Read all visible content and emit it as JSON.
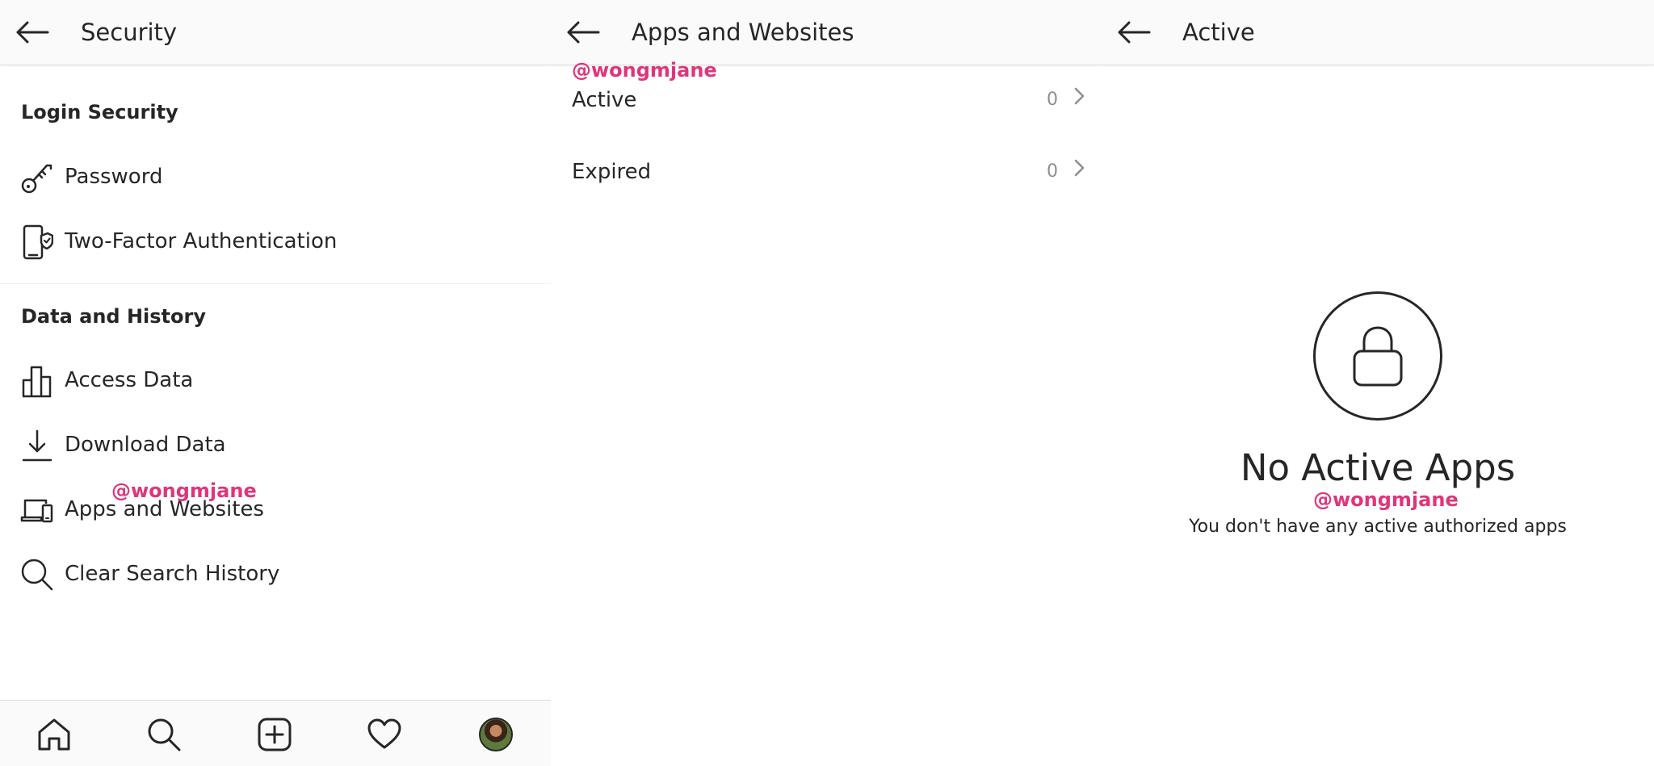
{
  "panels": {
    "security": {
      "title": "Security",
      "login_section": {
        "title": "Login Security",
        "items": [
          {
            "label": "Password",
            "icon": "key-icon"
          },
          {
            "label": "Two-Factor Authentication",
            "icon": "phone-shield-icon"
          }
        ]
      },
      "data_section": {
        "title": "Data and History",
        "items": [
          {
            "label": "Access Data",
            "icon": "bar-chart-icon"
          },
          {
            "label": "Download Data",
            "icon": "download-icon"
          },
          {
            "label": "Apps and Websites",
            "icon": "devices-icon"
          },
          {
            "label": "Clear Search History",
            "icon": "search-icon"
          }
        ]
      },
      "watermark": "@wongmjane",
      "tabbar": [
        {
          "name": "home",
          "icon": "home-icon"
        },
        {
          "name": "search",
          "icon": "search-icon"
        },
        {
          "name": "new-post",
          "icon": "plus-square-icon"
        },
        {
          "name": "activity",
          "icon": "heart-icon"
        },
        {
          "name": "profile",
          "icon": "avatar"
        }
      ]
    },
    "apps": {
      "title": "Apps and Websites",
      "watermark": "@wongmjane",
      "rows": [
        {
          "label": "Active",
          "count": "0"
        },
        {
          "label": "Expired",
          "count": "0"
        }
      ]
    },
    "active": {
      "title": "Active",
      "empty_title": "No Active Apps",
      "empty_subtitle": "You don't have any active authorized apps",
      "watermark": "@wongmjane",
      "icon": "lock-icon"
    }
  },
  "colors": {
    "header_bg": "#fafafa",
    "text": "#262626",
    "muted": "#8e8e8e",
    "divider": "#dbdbdb",
    "watermark": "#e0357b"
  }
}
